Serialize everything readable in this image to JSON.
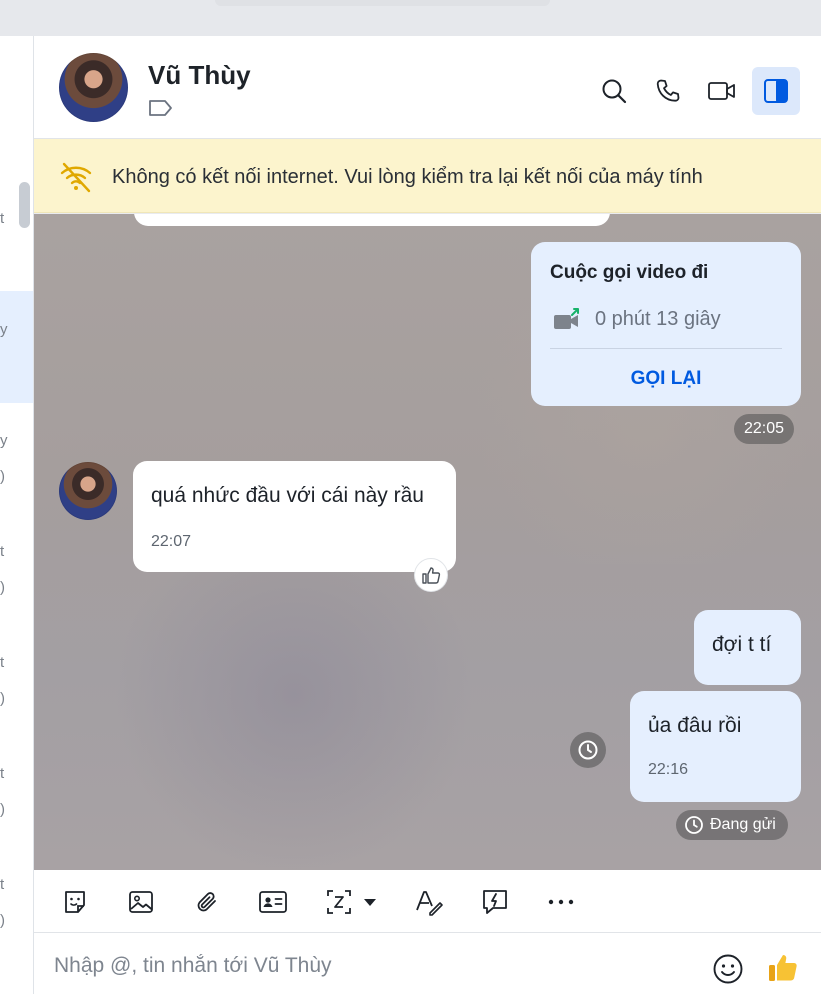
{
  "contact": {
    "name": "Vũ Thùy",
    "input_placeholder": "Nhập @, tin nhắn tới Vũ Thùy"
  },
  "banner": {
    "message": "Không có kết nối internet. Vui lòng kiểm tra lại kết nối của máy tính"
  },
  "left_fragments": [
    "t",
    "y",
    "y",
    ")",
    "t",
    ")",
    "t",
    ")",
    "t",
    ")",
    "t",
    ")"
  ],
  "messages": {
    "video_call": {
      "title": "Cuộc gọi video đi",
      "duration": "0 phút 13 giây",
      "action": "GỌI LẠI",
      "time": "22:05"
    },
    "incoming": {
      "text": "quá nhức đầu với cái này rầu",
      "time": "22:07"
    },
    "out1": {
      "text": "đợi t tí"
    },
    "out2": {
      "text": "ủa đâu rồi",
      "time": "22:16"
    },
    "status": "Đang gửi"
  },
  "icons": {
    "header": [
      "search-icon",
      "phone-icon",
      "video-call-icon",
      "panel-toggle-icon"
    ],
    "toolbar": [
      "sticker-icon",
      "image-icon",
      "attach-icon",
      "contact-card-icon",
      "screenshot-icon",
      "dropdown-icon",
      "text-format-icon",
      "quick-message-icon",
      "more-icon"
    ]
  },
  "colors": {
    "accent": "#005ae0",
    "outgoing_bubble": "#e5effe",
    "banner_bg": "#fcf4cd",
    "active_icon_bg": "#dce8fb"
  }
}
